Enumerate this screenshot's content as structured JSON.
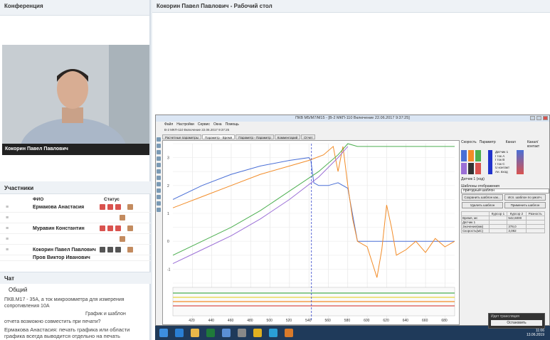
{
  "conference": {
    "title": "Конференция"
  },
  "video": {
    "name": "Кокорин Павел Павлович"
  },
  "participants": {
    "title": "Участники",
    "col_name": "ФИО",
    "col_status": "Статус",
    "rows": [
      {
        "name": "Ермакова Анастасия"
      },
      {
        "name": ""
      },
      {
        "name": "Муравин Константин"
      },
      {
        "name": ""
      },
      {
        "name": "Кокорин Павел Павлович"
      },
      {
        "name": "Пров Виктор Иванович"
      }
    ]
  },
  "chat": {
    "title": "Чат",
    "tab": "Общий",
    "messages": [
      "ПКВ.М17 - 35А, а ток микроомметра для измерения сопротивления 10А",
      "График и шаблон",
      "отчета возможно совместить при печати?",
      "Ермакова Анастасия: печать графика или области графика всегда выводится отдельно на печать"
    ]
  },
  "desktop": {
    "title": "Кокорин Павел Павлович - Рабочий стол"
  },
  "app": {
    "window_title": "ПКВ М5/М7/М15 - [В-2 МКП-110 Включение 22.06.2017 9:37:25]",
    "menu": [
      "Файл",
      "Настройки",
      "Сервис",
      "Окна",
      "Помощь"
    ],
    "subtitle": "В-2 МКП-110 Включение 22.06.2017 9:37:25",
    "tabs": [
      "Расчетные параметры",
      "Параметр - Время",
      "Параметр - Параметр",
      "Комментарий",
      "Отчет"
    ],
    "active_tab": 1,
    "right_panel": {
      "speed_label": "Скорость",
      "param_label": "Параметр",
      "channel_label": "Канал",
      "channels": [
        "Датчик 1",
        "I ток А",
        "I ток B",
        "I ток C",
        "U контакт",
        "Ан. вход"
      ],
      "ch_cont_label": "Канал/контакт",
      "sensor_label": "Датчик 1 (ход)",
      "templates_label": "Шаблоны отображения",
      "template_value": "пригодный шаблон",
      "btn_save": "Сохранить шаблон как...",
      "btn_use_default": "Исп. шаблон по умолч.",
      "btn_delete": "Удалить шаблон",
      "btn_apply": "Применить шаблон",
      "table_headers": [
        "",
        "Курсор 1",
        "Курсор 2",
        "Разность"
      ],
      "table_rows": [
        [
          "Время, мс",
          "",
          "542,6000",
          ""
        ],
        [
          "Датчик 1",
          "",
          "",
          ""
        ],
        [
          "Значение(мм)",
          "",
          "378,0",
          ""
        ],
        [
          "Скорость(м/с)",
          "",
          "3,082",
          ""
        ]
      ]
    },
    "chart_bottom_label": "В-2 МКП-110 Включение 22.06.2017 9:37:25"
  },
  "chart_data": {
    "type": "line",
    "x_ticks": [
      420,
      440,
      460,
      480,
      500,
      520,
      540,
      560,
      580,
      600,
      620,
      640,
      660,
      680
    ],
    "y_ticks": [
      "3",
      "2",
      "1",
      "0",
      "-1"
    ],
    "xlim": [
      400,
      690
    ],
    "ylim": [
      -1.5,
      3.5
    ],
    "cursor_x": 542.6,
    "series": [
      {
        "color": "#4a6fd6",
        "x": [
          400,
          430,
          460,
          490,
          520,
          540,
          542,
          545,
          550,
          560,
          570,
          580,
          590,
          600,
          620,
          650,
          690
        ],
        "y": [
          1.5,
          2.0,
          2.4,
          2.7,
          2.9,
          3.0,
          2.9,
          2.1,
          2.0,
          2.0,
          2.1,
          1.9,
          0.0,
          0.0,
          0.0,
          0.0,
          0.0
        ]
      },
      {
        "color": "#f28c28",
        "x": [
          400,
          430,
          460,
          490,
          520,
          540,
          555,
          565,
          570,
          575,
          580,
          585,
          590,
          600,
          610,
          615,
          620,
          625,
          630,
          640,
          650,
          660,
          670,
          680,
          690
        ],
        "y": [
          1.2,
          1.6,
          2.0,
          2.4,
          2.7,
          2.9,
          3.1,
          3.4,
          2.5,
          3.4,
          2.0,
          0.8,
          0.0,
          -0.2,
          -1.3,
          -0.3,
          1.3,
          0.5,
          -0.5,
          -0.3,
          0.0,
          -0.4,
          0.1,
          -0.2,
          0.0
        ]
      },
      {
        "color": "#4caf50",
        "x": [
          400,
          430,
          460,
          490,
          520,
          550,
          570,
          580,
          590,
          620,
          660,
          690
        ],
        "y": [
          -0.5,
          0.0,
          0.5,
          1.1,
          1.8,
          2.5,
          3.1,
          3.5,
          3.4,
          3.4,
          3.4,
          3.4
        ]
      },
      {
        "color": "#9b6fd6",
        "x": [
          400,
          430,
          460,
          490,
          520,
          550,
          570,
          580
        ],
        "y": [
          -0.8,
          -0.3,
          0.2,
          0.8,
          1.5,
          2.3,
          3.0,
          3.4
        ]
      }
    ]
  },
  "taskbar": {
    "clock_time": "11:06",
    "clock_date": "13.06.2019"
  },
  "share": {
    "label": "Идет трансляция",
    "stop": "Остановить"
  }
}
